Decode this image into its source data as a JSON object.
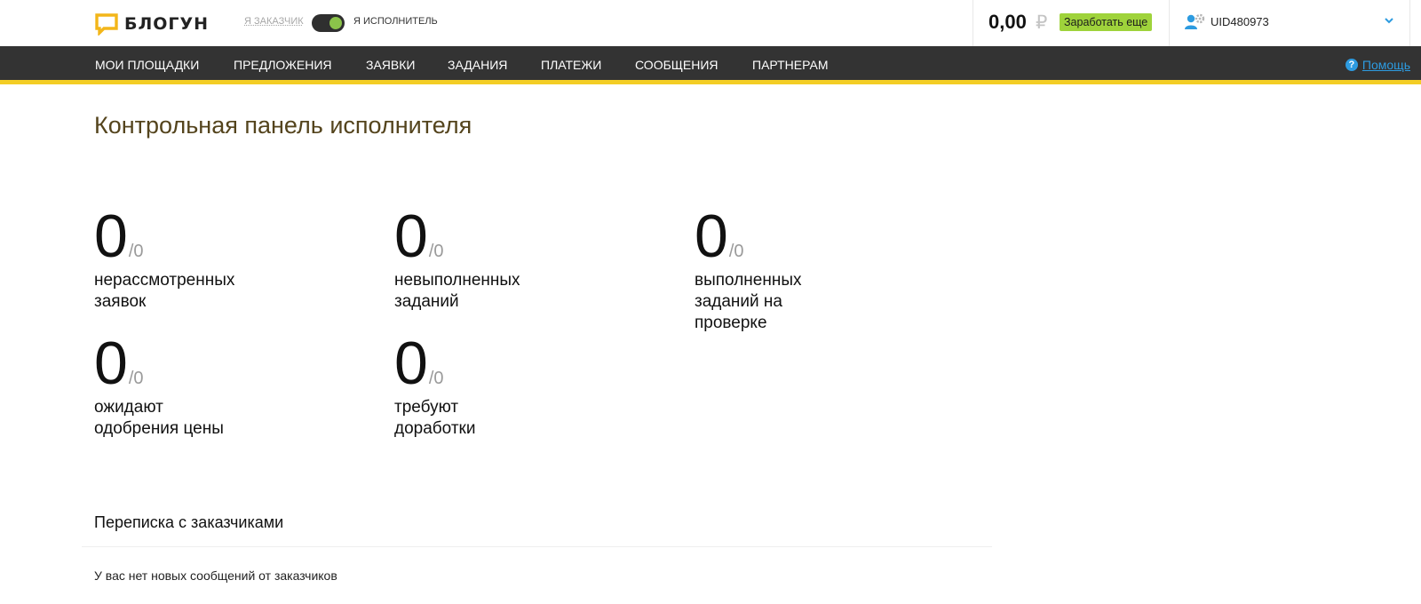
{
  "header": {
    "logo_text": "БЛОГУН",
    "role_client": "Я ЗАКАЗЧИК",
    "role_performer": "Я ИСПОЛНИТЕЛЬ",
    "balance": "0,00",
    "currency_symbol": "₽",
    "earn_more": "Заработать еще",
    "user_id": "UID480973"
  },
  "nav": {
    "items": [
      "МОИ ПЛОЩАДКИ",
      "ПРЕДЛОЖЕНИЯ",
      "ЗАЯВКИ",
      "ЗАДАНИЯ",
      "ПЛАТЕЖИ",
      "СООБЩЕНИЯ",
      "ПАРТНЕРАМ"
    ],
    "help_label": "Помощь"
  },
  "main": {
    "title": "Контрольная панель исполнителя",
    "stats": [
      {
        "value": "0",
        "total": "/0",
        "label_lines": [
          "нерассмотренных",
          "заявок"
        ]
      },
      {
        "value": "0",
        "total": "/0",
        "label_lines": [
          "невыполненных",
          "заданий"
        ]
      },
      {
        "value": "0",
        "total": "/0",
        "label_lines": [
          "выполненных",
          "заданий на",
          "проверке"
        ]
      },
      {
        "value": "0",
        "total": "/0",
        "label_lines": [
          "ожидают",
          "одобрения цены"
        ]
      },
      {
        "value": "0",
        "total": "/0",
        "label_lines": [
          "требуют",
          "доработки"
        ]
      }
    ],
    "messages_title": "Переписка с заказчиками",
    "messages_empty": "У вас нет новых сообщений от заказчиков"
  },
  "colors": {
    "nav_bg": "#333333",
    "nav_accent": "#f3cd25",
    "earn_button": "#9fd33b",
    "toggle_on": "#8bc34a",
    "link": "#2d9be0",
    "title": "#54441d"
  },
  "icons": [
    "logo-speech-bubble-icon",
    "user-settings-icon",
    "chevron-down-icon",
    "help-question-icon"
  ]
}
